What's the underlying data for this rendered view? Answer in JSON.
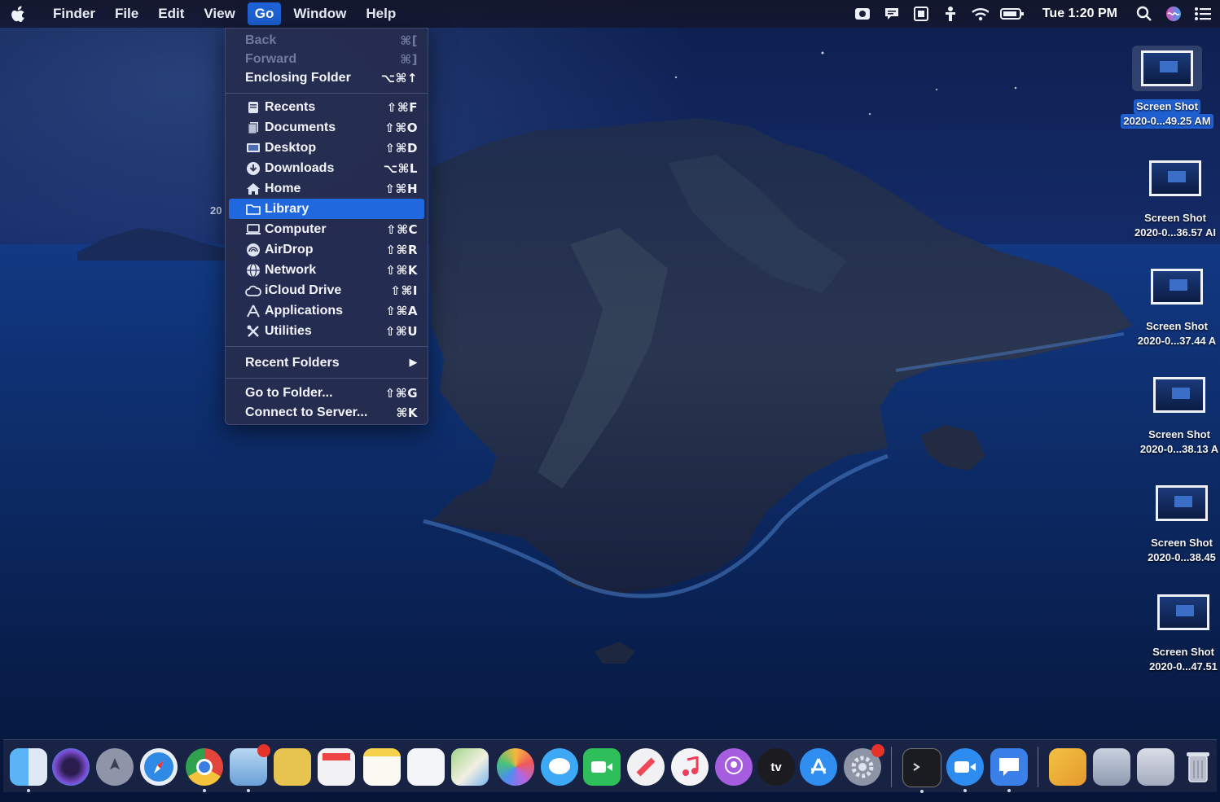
{
  "menubar": {
    "items": [
      {
        "label": "Finder"
      },
      {
        "label": "File"
      },
      {
        "label": "Edit"
      },
      {
        "label": "View"
      },
      {
        "label": "Go",
        "active": true
      },
      {
        "label": "Window"
      },
      {
        "label": "Help"
      }
    ],
    "clock": "Tue 1:20 PM",
    "status_icons": [
      "screen-record-icon",
      "feedback-icon",
      "display-icon",
      "accessibility-icon",
      "wifi-icon",
      "battery-icon",
      "search-icon",
      "siri-icon",
      "notification-center-icon"
    ]
  },
  "go_menu": {
    "items": [
      {
        "label": "Back",
        "shortcut": "⌘[",
        "disabled": true
      },
      {
        "label": "Forward",
        "shortcut": "⌘]",
        "disabled": true
      },
      {
        "label": "Enclosing Folder",
        "shortcut": "⌥⌘↑"
      },
      {
        "label": "Recents",
        "shortcut": "⇧⌘F",
        "icon": "recents-icon"
      },
      {
        "label": "Documents",
        "shortcut": "⇧⌘O",
        "icon": "documents-icon"
      },
      {
        "label": "Desktop",
        "shortcut": "⇧⌘D",
        "icon": "desktop-icon"
      },
      {
        "label": "Downloads",
        "shortcut": "⌥⌘L",
        "icon": "downloads-icon"
      },
      {
        "label": "Home",
        "shortcut": "⇧⌘H",
        "icon": "home-icon"
      },
      {
        "label": "Library",
        "shortcut": "",
        "icon": "library-folder-icon",
        "highlighted": true
      },
      {
        "label": "Computer",
        "shortcut": "⇧⌘C",
        "icon": "computer-icon"
      },
      {
        "label": "AirDrop",
        "shortcut": "⇧⌘R",
        "icon": "airdrop-icon"
      },
      {
        "label": "Network",
        "shortcut": "⇧⌘K",
        "icon": "network-icon"
      },
      {
        "label": "iCloud Drive",
        "shortcut": "⇧⌘I",
        "icon": "icloud-icon"
      },
      {
        "label": "Applications",
        "shortcut": "⇧⌘A",
        "icon": "applications-icon"
      },
      {
        "label": "Utilities",
        "shortcut": "⇧⌘U",
        "icon": "utilities-icon"
      },
      {
        "label": "Recent Folders",
        "shortcut": "▶"
      },
      {
        "label": "Go to Folder...",
        "shortcut": "⇧⌘G"
      },
      {
        "label": "Connect to Server...",
        "shortcut": "⌘K"
      }
    ]
  },
  "peek_label": "20",
  "desktop_icons": [
    {
      "title": "Screen Shot",
      "subtitle": "2020-0...49.25 AM",
      "selected": true
    },
    {
      "title": "Screen Shot",
      "subtitle": "2020-0...36.57 AI"
    },
    {
      "title": "Screen Shot",
      "subtitle": "2020-0...37.44 A"
    },
    {
      "title": "Screen Shot",
      "subtitle": "2020-0...38.13 A"
    },
    {
      "title": "Screen Shot",
      "subtitle": "2020-0...38.45"
    },
    {
      "title": "Screen Shot",
      "subtitle": "2020-0...47.51"
    }
  ],
  "dock": {
    "apps": [
      "finder",
      "siri",
      "launchpad",
      "safari",
      "chrome",
      "preview",
      "notes-yellow",
      "calendar",
      "notes",
      "reminders",
      "maps",
      "photos",
      "messages",
      "facetime",
      "news",
      "music",
      "podcasts",
      "apple-tv",
      "app-store",
      "system-preferences",
      "terminal",
      "zoom",
      "feedback-assistant",
      "folder-stack",
      "screenshot-stack",
      "downloads-stack",
      "trash"
    ],
    "tv_label": "tv"
  },
  "colors": {
    "menu_highlight": "#1f68de",
    "menubar_bg": "#14162a",
    "menu_bg": "#262c4e"
  }
}
